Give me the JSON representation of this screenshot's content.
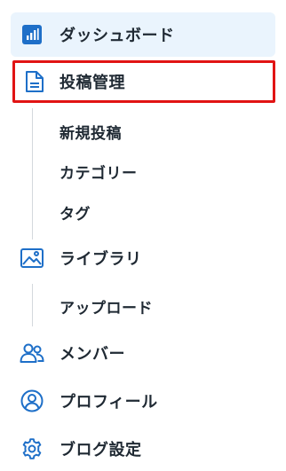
{
  "colors": {
    "accent": "#1e6fc8",
    "active_bg": "#eaf4fd",
    "highlight_border": "#e11414"
  },
  "menu": {
    "dashboard": {
      "label": "ダッシュボード",
      "icon": "bar-chart-icon"
    },
    "posts": {
      "label": "投稿管理",
      "icon": "document-icon",
      "children": [
        "新規投稿",
        "カテゴリー",
        "タグ"
      ]
    },
    "library": {
      "label": "ライブラリ",
      "icon": "image-icon",
      "children": [
        "アップロード"
      ]
    },
    "members": {
      "label": "メンバー",
      "icon": "users-icon"
    },
    "profile": {
      "label": "プロフィール",
      "icon": "user-circle-icon"
    },
    "blog_settings": {
      "label": "ブログ設定",
      "icon": "gear-icon"
    }
  }
}
